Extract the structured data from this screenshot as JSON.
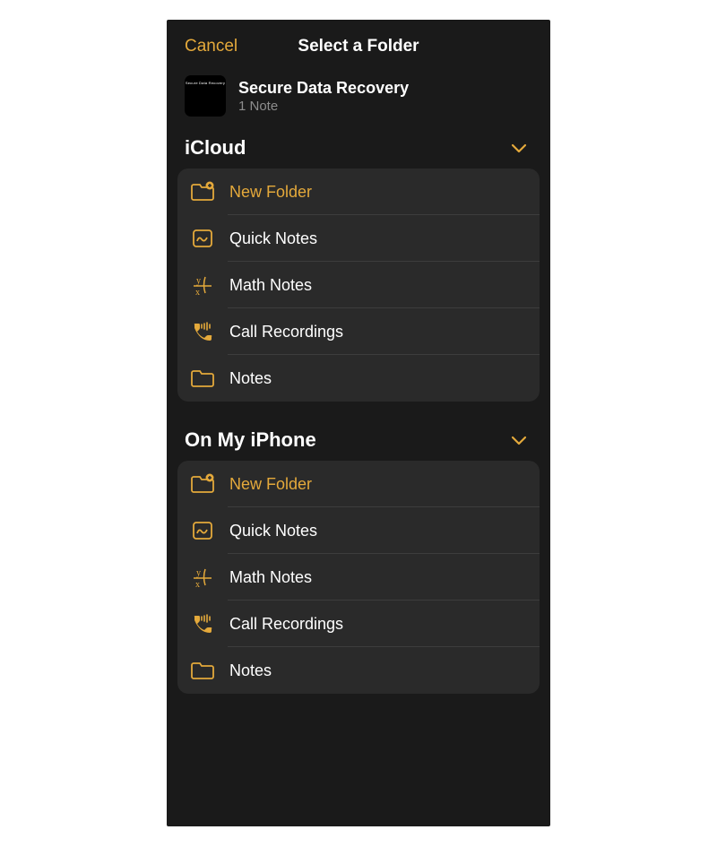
{
  "colors": {
    "accent": "#e4a93b",
    "bg": "#1a1a1a",
    "card": "#2a2a2a"
  },
  "header": {
    "cancel": "Cancel",
    "title": "Select a Folder"
  },
  "note": {
    "thumb_text": "Secure Data Recovery",
    "title": "Secure Data Recovery",
    "subtitle": "1 Note"
  },
  "sections": [
    {
      "title": "iCloud",
      "items": [
        {
          "icon": "new-folder",
          "label": "New Folder",
          "accent": true
        },
        {
          "icon": "quick-notes",
          "label": "Quick Notes"
        },
        {
          "icon": "math-notes",
          "label": "Math Notes"
        },
        {
          "icon": "call-recordings",
          "label": "Call Recordings"
        },
        {
          "icon": "folder",
          "label": "Notes"
        }
      ]
    },
    {
      "title": "On My iPhone",
      "items": [
        {
          "icon": "new-folder",
          "label": "New Folder",
          "accent": true
        },
        {
          "icon": "quick-notes",
          "label": "Quick Notes"
        },
        {
          "icon": "math-notes",
          "label": "Math Notes"
        },
        {
          "icon": "call-recordings",
          "label": "Call Recordings"
        },
        {
          "icon": "folder",
          "label": "Notes"
        }
      ]
    }
  ]
}
